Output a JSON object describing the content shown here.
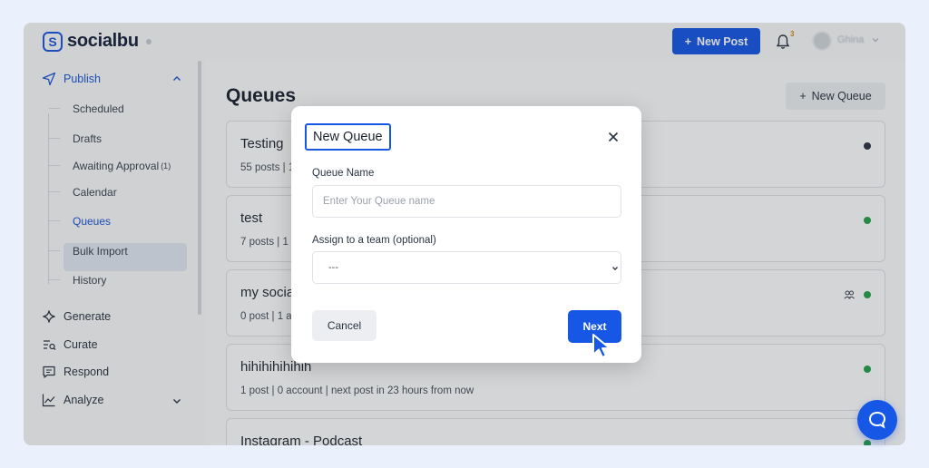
{
  "app": {
    "brand": "socialbu",
    "logo_letter": "S",
    "new_post_label": "New Post",
    "notification_count": "3",
    "user_name": "Ghina"
  },
  "sidebar": {
    "sections": [
      {
        "label": "Publish",
        "icon": "send-icon",
        "expanded": true
      },
      {
        "label": "Generate",
        "icon": "sparkle-icon"
      },
      {
        "label": "Curate",
        "icon": "curate-icon"
      },
      {
        "label": "Respond",
        "icon": "chat-icon"
      },
      {
        "label": "Analyze",
        "icon": "chart-icon",
        "expandable": true
      }
    ],
    "publish_items": [
      {
        "label": "Scheduled"
      },
      {
        "label": "Drafts"
      },
      {
        "label": "Awaiting Approval",
        "count": "(1)"
      },
      {
        "label": "Calendar"
      },
      {
        "label": "Queues",
        "active": true
      },
      {
        "label": "Bulk Import"
      },
      {
        "label": "History"
      }
    ]
  },
  "main": {
    "title": "Queues",
    "new_queue_label": "New Queue",
    "queues": [
      {
        "name": "Testing",
        "meta": "55 posts | 1",
        "status_color": "#2d3245"
      },
      {
        "name": "test",
        "meta": "7 posts | 1 a",
        "status_color": "#23a047"
      },
      {
        "name": "my socia",
        "meta": "0 post | 1 a",
        "status_color": "#23a047",
        "shared": true
      },
      {
        "name": "hihihihihihih",
        "meta": "1 post | 0 account | next post in 23 hours from now",
        "status_color": "#23a047"
      },
      {
        "name": "Instagram - Podcast",
        "meta": "",
        "status_color": "#23a047"
      }
    ]
  },
  "modal": {
    "title": "New Queue",
    "queue_name_label": "Queue Name",
    "queue_name_placeholder": "Enter Your Queue name",
    "queue_name_value": "",
    "team_label": "Assign to a team (optional)",
    "team_selected": "---",
    "cancel_label": "Cancel",
    "next_label": "Next"
  },
  "colors": {
    "accent": "#1657e6",
    "status_green": "#23a047",
    "status_dark": "#2d3245"
  }
}
